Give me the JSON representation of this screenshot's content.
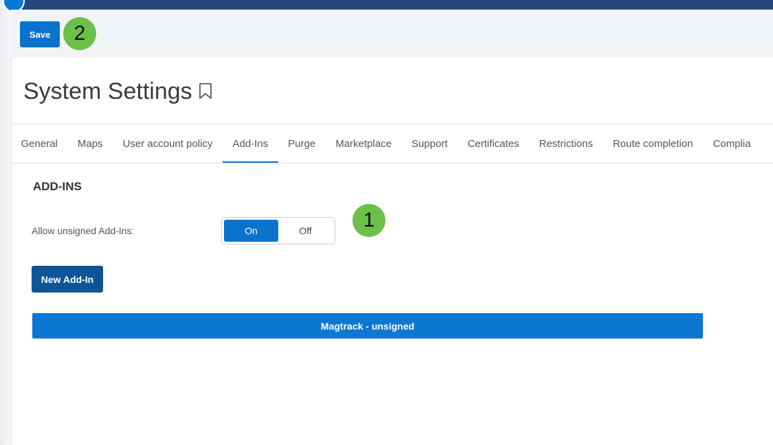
{
  "toolbar": {
    "save_label": "Save"
  },
  "annotations": {
    "badge_1": "1",
    "badge_2": "2"
  },
  "page": {
    "title": "System Settings",
    "title_icon": "bookmark-icon"
  },
  "tabs": [
    {
      "label": "General",
      "active": false
    },
    {
      "label": "Maps",
      "active": false
    },
    {
      "label": "User account policy",
      "active": false
    },
    {
      "label": "Add-Ins",
      "active": true
    },
    {
      "label": "Purge",
      "active": false
    },
    {
      "label": "Marketplace",
      "active": false
    },
    {
      "label": "Support",
      "active": false
    },
    {
      "label": "Certificates",
      "active": false
    },
    {
      "label": "Restrictions",
      "active": false
    },
    {
      "label": "Route completion",
      "active": false
    },
    {
      "label": "Complia",
      "active": false
    }
  ],
  "addins": {
    "section_title": "ADD-INS",
    "unsigned_label": "Allow unsigned Add-Ins:",
    "toggle": {
      "on_label": "On",
      "off_label": "Off",
      "selected": "On"
    },
    "new_button_label": "New Add-In",
    "items": [
      {
        "label": "Magtrack - unsigned"
      }
    ]
  },
  "colors": {
    "accent": "#0b73cc",
    "dark_button": "#0e5597",
    "header_bar": "#25477a",
    "badge": "#6cc04a"
  }
}
